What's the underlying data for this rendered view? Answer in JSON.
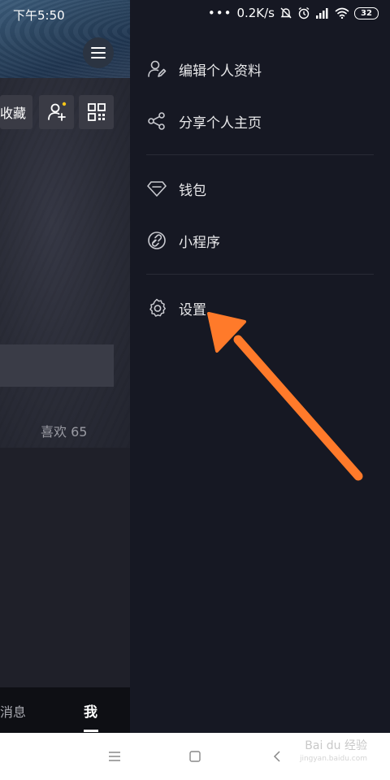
{
  "status_bar": {
    "time": "下午5:50",
    "network_speed": "0.2K/s",
    "battery": "32"
  },
  "profile": {
    "favorites_label": "收藏",
    "likes_label": "喜欢 65"
  },
  "bottom_nav": {
    "messages": "消息",
    "me": "我"
  },
  "drawer": {
    "items": [
      {
        "label": "编辑个人资料",
        "icon": "edit-profile-icon"
      },
      {
        "label": "分享个人主页",
        "icon": "share-icon"
      },
      {
        "label": "钱包",
        "icon": "wallet-diamond-icon"
      },
      {
        "label": "小程序",
        "icon": "mini-program-link-icon"
      },
      {
        "label": "设置",
        "icon": "gear-icon"
      }
    ]
  },
  "annotation": {
    "arrow_color": "#ff7a2a"
  },
  "watermark": {
    "text": "Bai du 经验",
    "sub": "jingyan.baidu.com"
  }
}
